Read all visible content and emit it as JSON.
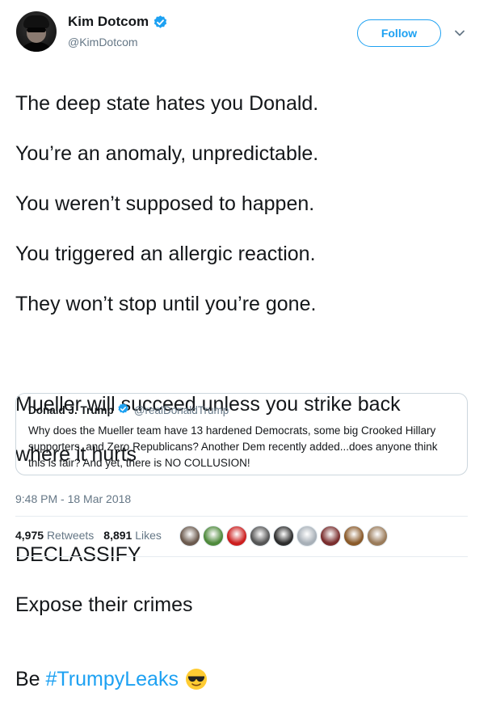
{
  "author": {
    "display_name": "Kim Dotcom",
    "handle": "@KimDotcom",
    "verified_icon": "verified-badge-icon",
    "avatar": "avatar"
  },
  "follow_button": {
    "label": "Follow"
  },
  "caret_icon": "chevron-down-icon",
  "tweet": {
    "lines": [
      "The deep state hates you Donald.",
      "You’re an anomaly, unpredictable.",
      "You weren’t supposed to happen.",
      "You triggered an allergic reaction.",
      "They won’t stop until you’re gone.",
      "Mueller will succeed unless you strike back",
      "where it hurts",
      "DECLASSIFY",
      "Expose their crimes"
    ],
    "last_line_prefix": "Be ",
    "hashtag": "#TrumpyLeaks",
    "emoji": "smiling-face-with-sunglasses-icon"
  },
  "quoted_tweet": {
    "display_name": "Donald J. Trump",
    "handle": "@realDonaldTrump",
    "text": "Why does the Mueller team have 13 hardened Democrats, some big Crooked Hillary supporters, and Zero Republicans? Another Dem recently added...does anyone think this is fair? And yet, there is NO COLLUSION!"
  },
  "timestamp": "9:48 PM - 18 Mar 2018",
  "stats": {
    "retweets_count": "4,975",
    "retweets_label": "Retweets",
    "likes_count": "8,891",
    "likes_label": "Likes"
  },
  "likers": [
    {
      "color": "#6b5a4e"
    },
    {
      "color": "#4f8a3c"
    },
    {
      "color": "#cc1f1f"
    },
    {
      "color": "#555555"
    },
    {
      "color": "#2d2d2d"
    },
    {
      "color": "#a8b0b8"
    },
    {
      "color": "#7a2e2e"
    },
    {
      "color": "#8a5a2a"
    },
    {
      "color": "#9a7b5a"
    }
  ],
  "colors": {
    "accent": "#1da1f2",
    "text": "#14171a",
    "muted": "#657786",
    "border": "#ccd6dd"
  }
}
